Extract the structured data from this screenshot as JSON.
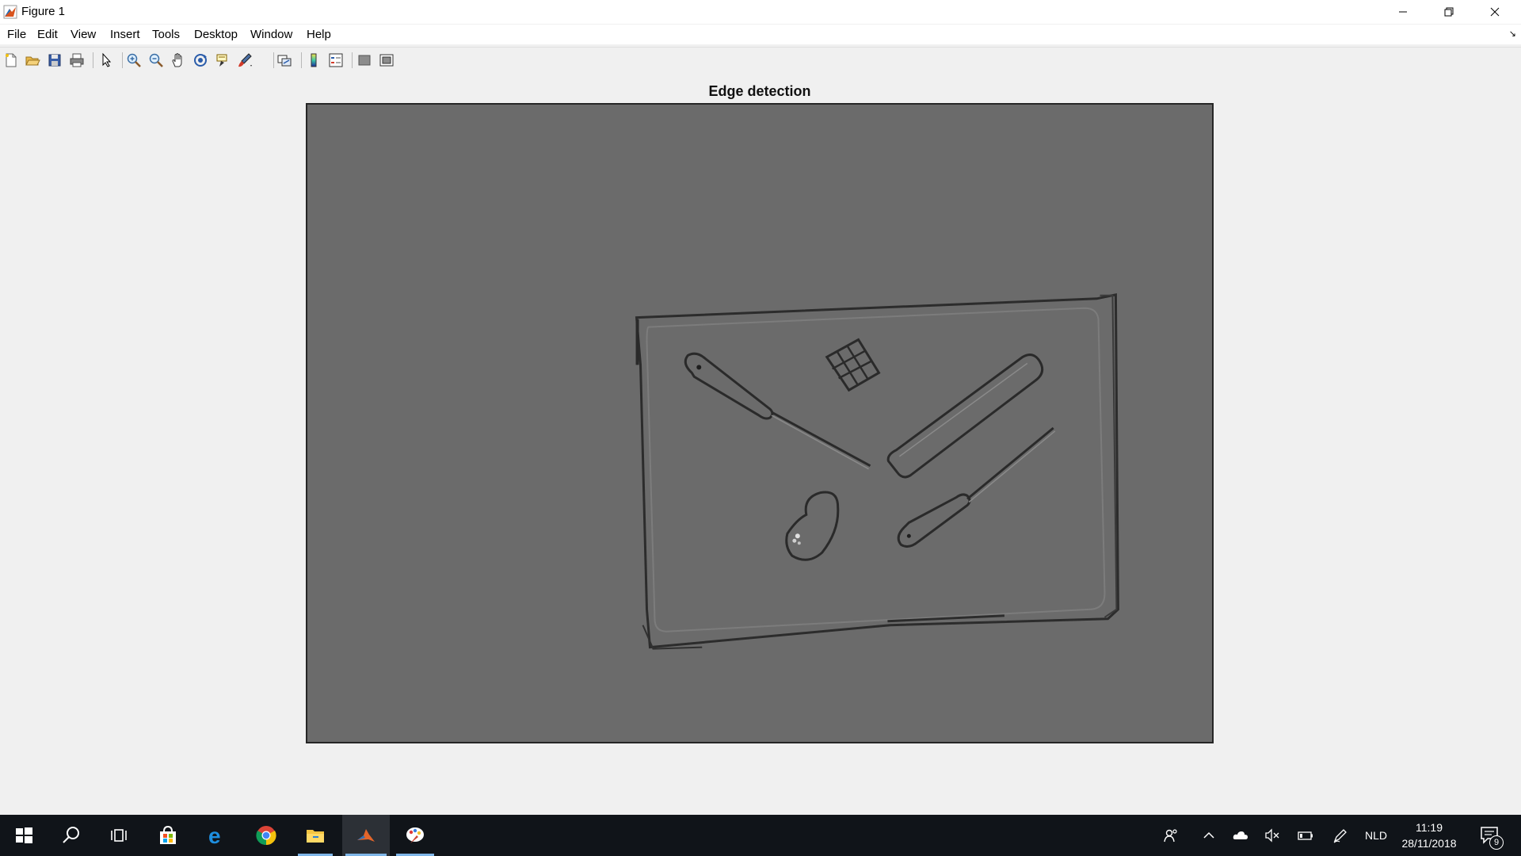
{
  "window": {
    "title": "Figure 1"
  },
  "menu": {
    "items": [
      {
        "label": "File"
      },
      {
        "label": "Edit"
      },
      {
        "label": "View"
      },
      {
        "label": "Insert"
      },
      {
        "label": "Tools"
      },
      {
        "label": "Desktop"
      },
      {
        "label": "Window"
      },
      {
        "label": "Help"
      }
    ]
  },
  "toolbar": {
    "tools": [
      {
        "icon": "new-figure-icon"
      },
      {
        "icon": "open-file-icon"
      },
      {
        "icon": "save-icon"
      },
      {
        "icon": "print-icon"
      },
      {
        "icon": "edit-plot-pointer-icon"
      },
      {
        "icon": "zoom-in-icon"
      },
      {
        "icon": "zoom-out-icon"
      },
      {
        "icon": "pan-hand-icon"
      },
      {
        "icon": "rotate-3d-icon"
      },
      {
        "icon": "data-cursor-icon"
      },
      {
        "icon": "brush-icon"
      },
      {
        "icon": "link-plot-icon"
      },
      {
        "icon": "insert-colorbar-icon"
      },
      {
        "icon": "insert-legend-icon"
      },
      {
        "icon": "hide-plot-tools-icon"
      },
      {
        "icon": "show-plot-tools-icon"
      }
    ]
  },
  "figure": {
    "title": "Edge detection",
    "image_background": "#6b6b6b",
    "edge_color": "#2a2a2a",
    "highlight_color": "#8a8a8a"
  },
  "taskbar": {
    "apps": [
      {
        "icon": "windows-start-icon"
      },
      {
        "icon": "search-icon"
      },
      {
        "icon": "task-view-icon"
      },
      {
        "icon": "store-icon"
      },
      {
        "icon": "edge-browser-icon"
      },
      {
        "icon": "chrome-icon"
      },
      {
        "icon": "file-explorer-icon"
      },
      {
        "icon": "matlab-icon"
      },
      {
        "icon": "paint-app-icon"
      }
    ],
    "language": "NLD",
    "time": "11:19",
    "date": "28/11/2018",
    "notifications": "9"
  }
}
